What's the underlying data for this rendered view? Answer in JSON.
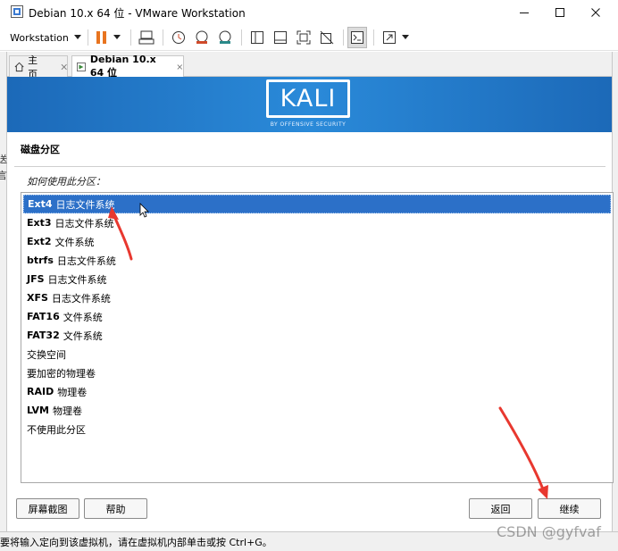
{
  "window": {
    "title": "Debian 10.x 64 位 - VMware Workstation",
    "controls": [
      "minimize",
      "maximize",
      "close"
    ]
  },
  "toolbar": {
    "menu_label": "Workstation",
    "icons": [
      "pause-icon",
      "send-ctrl-alt-del-icon",
      "snapshot-icon",
      "revert-snapshot-icon",
      "snapshot-manager-icon",
      "sidebar-view-icon",
      "console-view-icon",
      "fullscreen-icon",
      "unity-icon",
      "terminal-icon",
      "stretch-icon"
    ]
  },
  "tabs": [
    {
      "label": "主页",
      "active": false
    },
    {
      "label": "Debian 10.x 64 位",
      "active": true
    }
  ],
  "installer": {
    "logo_text": "KALI",
    "logo_subtitle": "BY OFFENSIVE SECURITY",
    "heading": "磁盘分区",
    "question": "如何使用此分区：",
    "options": [
      {
        "fs": "Ext4",
        "desc": "日志文件系统",
        "selected": true
      },
      {
        "fs": "Ext3",
        "desc": "日志文件系统",
        "selected": false
      },
      {
        "fs": "Ext2",
        "desc": "文件系统",
        "selected": false
      },
      {
        "fs": "btrfs",
        "desc": "日志文件系统",
        "selected": false
      },
      {
        "fs": "JFS",
        "desc": "日志文件系统",
        "selected": false
      },
      {
        "fs": "XFS",
        "desc": "日志文件系统",
        "selected": false
      },
      {
        "fs": "FAT16",
        "desc": "文件系统",
        "selected": false
      },
      {
        "fs": "FAT32",
        "desc": "文件系统",
        "selected": false
      },
      {
        "fs": "",
        "desc": "交换空间",
        "selected": false
      },
      {
        "fs": "",
        "desc": "要加密的物理卷",
        "selected": false
      },
      {
        "fs": "RAID",
        "desc": "物理卷",
        "selected": false
      },
      {
        "fs": "LVM",
        "desc": "物理卷",
        "selected": false
      },
      {
        "fs": "",
        "desc": "不使用此分区",
        "selected": false
      }
    ],
    "buttons": {
      "screenshot": "屏幕截图",
      "help": "帮助",
      "back": "返回",
      "continue": "继续"
    }
  },
  "statusbar": {
    "text": "要将输入定向到该虚拟机，请在虚拟机内部单击或按 Ctrl+G。"
  },
  "watermark": "CSDN @gyfvaf",
  "colors": {
    "banner": "#1c69b8",
    "selection": "#2c70c8",
    "annotation_arrow": "#e8382f"
  }
}
